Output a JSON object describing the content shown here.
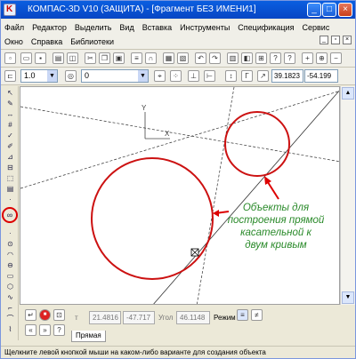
{
  "window": {
    "title": "КОМПАС-3D V10 (ЗАЩИТА) - [Фрагмент БЕЗ ИМЕНИ1]"
  },
  "menu": {
    "row1": [
      "Файл",
      "Редактор",
      "Выделить",
      "Вид",
      "Вставка",
      "Инструменты",
      "Спецификация",
      "Сервис"
    ],
    "row2": [
      "Окно",
      "Справка",
      "Библиотеки"
    ]
  },
  "props_toolbar": {
    "line_scale": "1.0",
    "layer": "0",
    "cursor_x": "39.1823",
    "cursor_y": "-54.199"
  },
  "params_panel": {
    "field1": "21.4816",
    "field2": "-47.717",
    "angle_label": "Угол",
    "angle_value": "46.1148",
    "mode_label": "Режим",
    "tab_label": "Прямая"
  },
  "annotation": {
    "lines": [
      "Объекты для",
      "построения прямой",
      "касательной к",
      "двум кривым"
    ],
    "color": "#2a8a2a"
  },
  "canvas": {
    "axis_y_label": "Y",
    "axis_x_label": "X"
  },
  "colors": {
    "circle_stroke": "#cc1111",
    "titlebar": "#0a5ee0"
  },
  "status": "Щелкните левой кнопкой мыши на каком-либо варианте для создания объекта"
}
